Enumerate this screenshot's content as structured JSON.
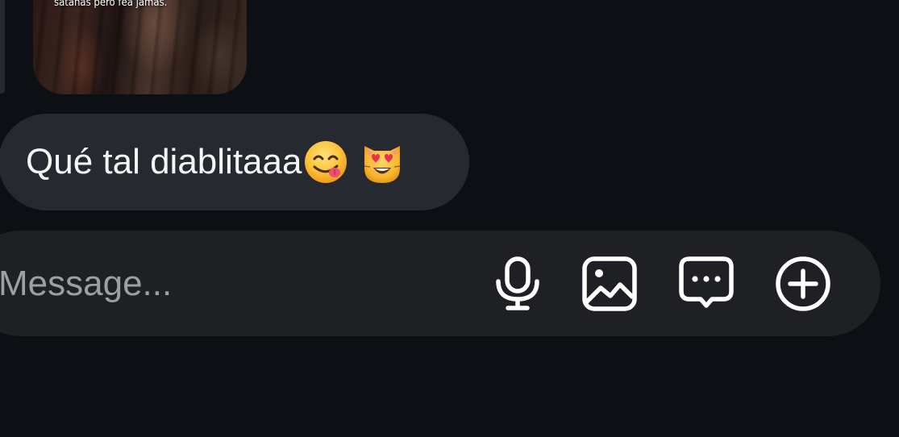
{
  "media_preview": {
    "caption": "satanas pero fea jamas."
  },
  "message": {
    "text": "Qué tal diablitaaa",
    "emojis": [
      "face-savoring-food-icon",
      "smiling-cat-heart-eyes-icon"
    ]
  },
  "composer": {
    "placeholder": "Message...",
    "value": "",
    "icons": [
      "microphone-icon",
      "image-icon",
      "sticker-chat-icon",
      "add-circle-icon"
    ]
  },
  "colors": {
    "background": "#0c1014",
    "bubble": "#262a30",
    "composer": "#1f2023",
    "placeholder": "#9aa0a6",
    "text": "#f5f5f5"
  }
}
